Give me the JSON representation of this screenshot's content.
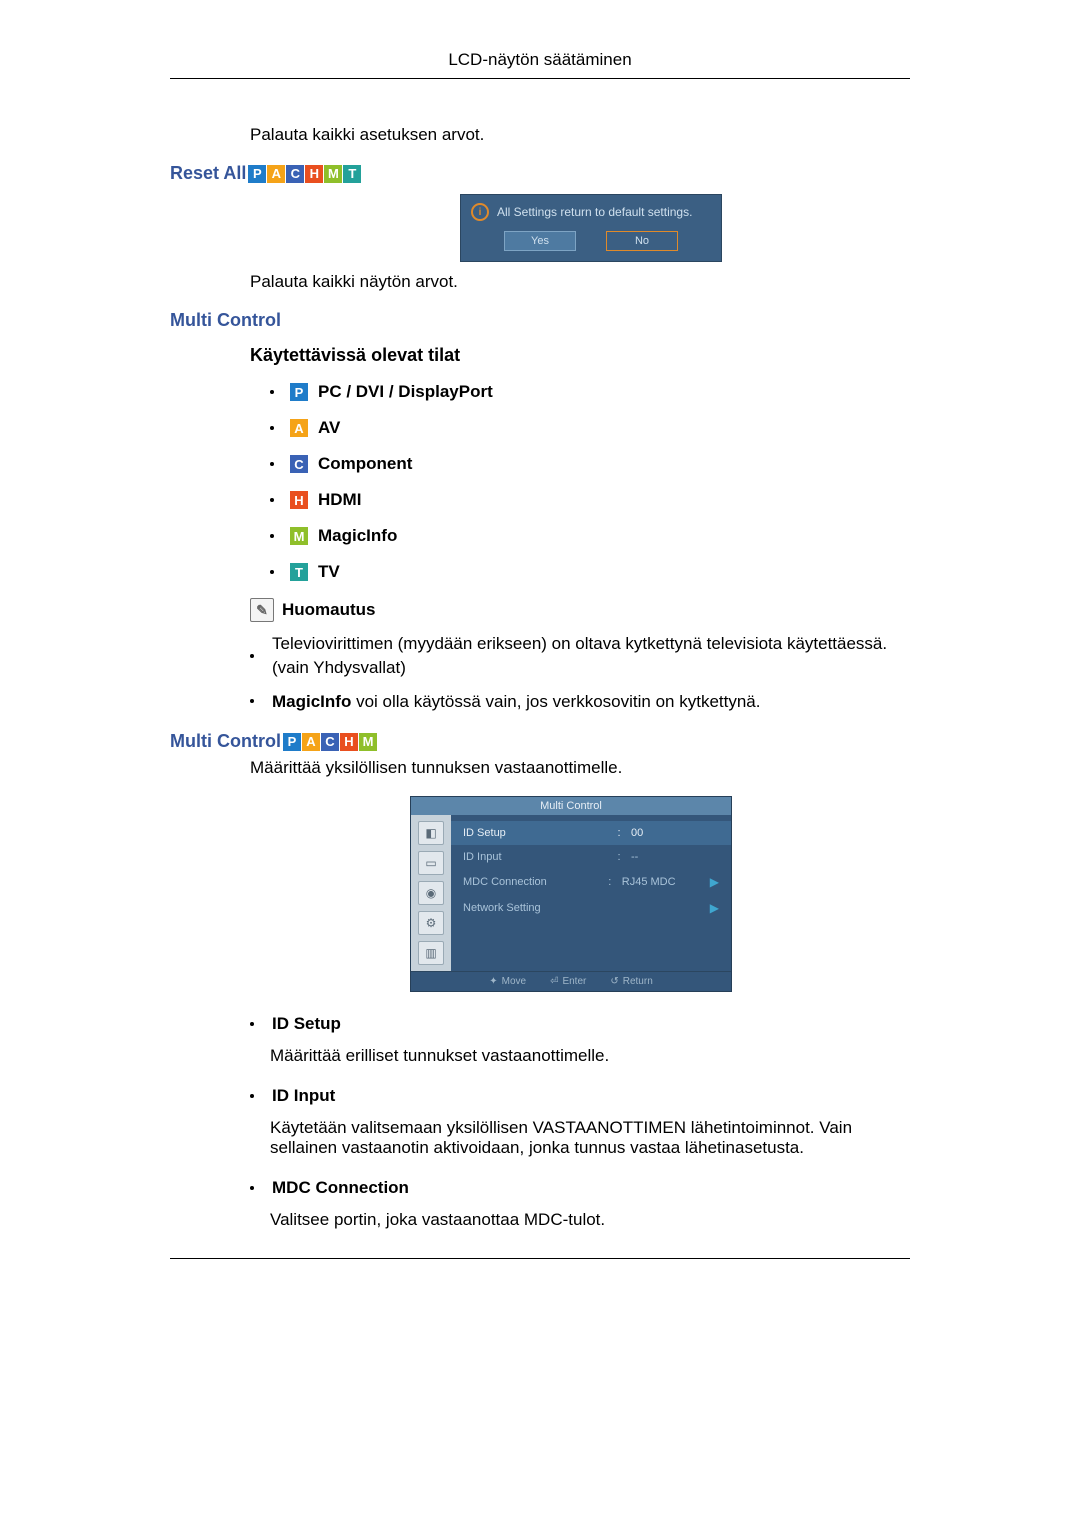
{
  "header": {
    "title": "LCD-näytön säätäminen"
  },
  "texts": {
    "restore_settings": "Palauta kaikki asetuksen arvot.",
    "restore_display": "Palauta kaikki näytön arvot.",
    "multi_desc": "Määrittää yksilöllisen tunnuksen vastaanottimelle.",
    "id_setup_desc": "Määrittää erilliset tunnukset vastaanottimelle.",
    "id_input_desc": "Käytetään valitsemaan yksilöllisen VASTAANOTTIMEN lähetintoiminnot. Vain sellainen vastaanotin aktivoidaan, jonka tunnus vastaa lähetinasetusta.",
    "mdc_desc": "Valitsee portin, joka vastaanottaa MDC-tulot."
  },
  "sections": {
    "reset_all": "Reset All",
    "multi_control": "Multi Control",
    "available_modes": "Käytettävissä olevat tilat",
    "multi_control2": "Multi Control"
  },
  "modes": [
    {
      "iconClass": "icon-P",
      "letter": "P",
      "label": "PC / DVI / DisplayPort"
    },
    {
      "iconClass": "icon-A",
      "letter": "A",
      "label": "AV"
    },
    {
      "iconClass": "icon-C",
      "letter": "C",
      "label": "Component"
    },
    {
      "iconClass": "icon-H",
      "letter": "H",
      "label": "HDMI"
    },
    {
      "iconClass": "icon-M",
      "letter": "M",
      "label": "MagicInfo"
    },
    {
      "iconClass": "icon-T",
      "letter": "T",
      "label": "TV"
    }
  ],
  "note": {
    "label": "Huomautus",
    "items": [
      "Televiovirittimen (myydään erikseen) on oltava kytkettynä televisiota käytettäessä. (vain Yhdysvallat)",
      "MagicInfo voi olla käytössä vain, jos verkkosovitin on kytkettynä."
    ],
    "bold_prefix": "MagicInfo"
  },
  "dialog": {
    "message": "All Settings return to default settings.",
    "yes": "Yes",
    "no": "No"
  },
  "osd": {
    "title": "Multi Control",
    "rows": [
      {
        "label": "ID Setup",
        "value": "00",
        "arrow": false,
        "selected": true
      },
      {
        "label": "ID Input",
        "value": "--",
        "arrow": false,
        "selected": false
      },
      {
        "label": "MDC Connection",
        "value": "RJ45 MDC",
        "arrow": true,
        "selected": false
      },
      {
        "label": "Network Setting",
        "value": "",
        "arrow": true,
        "selected": false
      }
    ],
    "footer": {
      "move": "Move",
      "enter": "Enter",
      "return": "Return"
    }
  },
  "definitions": {
    "id_setup": "ID Setup",
    "id_input": "ID Input",
    "mdc_connection": "MDC Connection"
  }
}
